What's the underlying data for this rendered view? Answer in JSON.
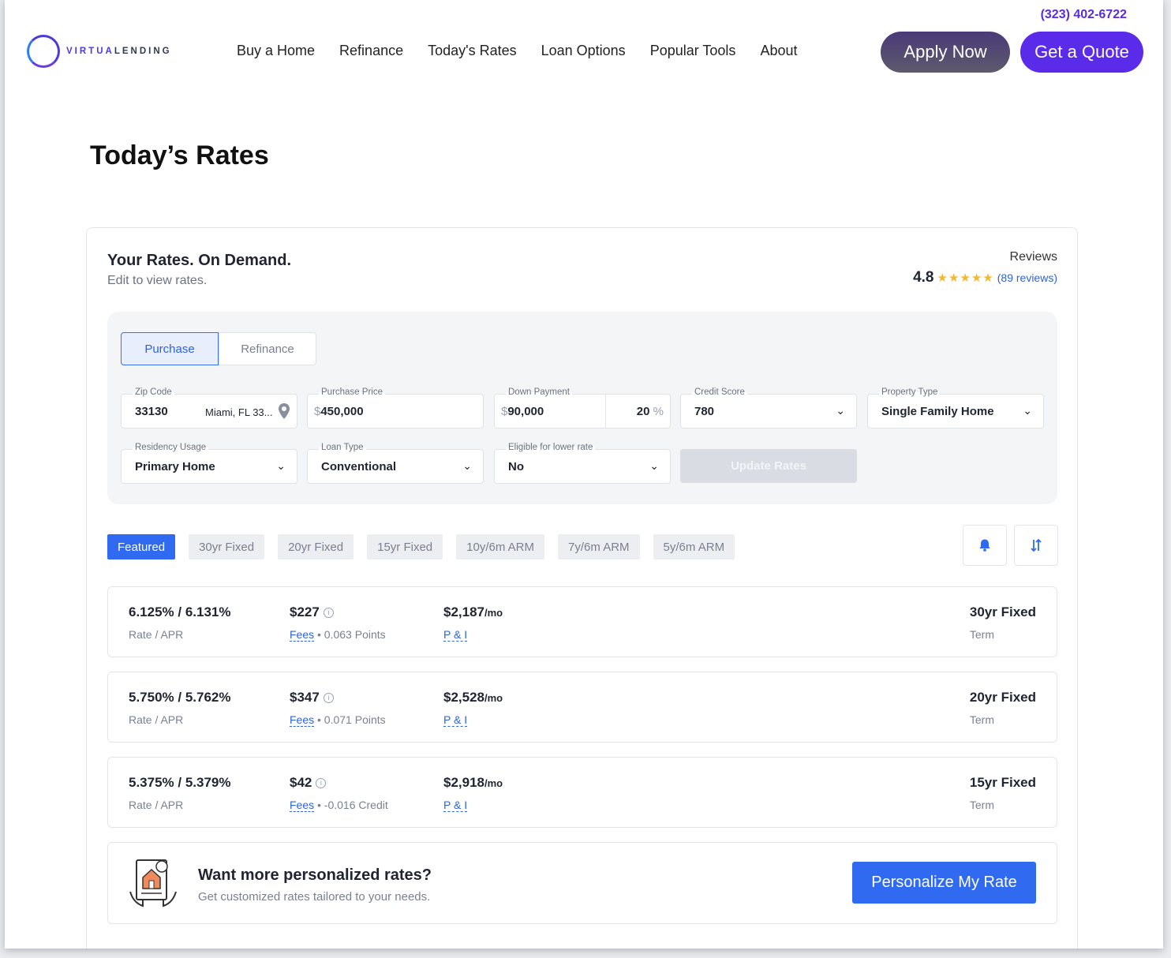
{
  "header": {
    "phone": "(323) 402-6722",
    "logo_prefix": "VIRTUA",
    "logo_suffix": "LENDING",
    "nav": [
      "Buy a Home",
      "Refinance",
      "Today's Rates",
      "Loan Options",
      "Popular Tools",
      "About"
    ],
    "apply_label": "Apply Now",
    "quote_label": "Get a Quote"
  },
  "page_title": "Today’s Rates",
  "card": {
    "title": "Your Rates. On Demand.",
    "subtitle": "Edit to view rates.",
    "reviews_label": "Reviews",
    "rating": "4.8",
    "stars": "★★★★★",
    "reviews_link": "(89 reviews)"
  },
  "form": {
    "segments": [
      "Purchase",
      "Refinance"
    ],
    "zip": {
      "label": "Zip Code",
      "value": "33130",
      "city": "Miami, FL 33..."
    },
    "purchase_price": {
      "label": "Purchase Price",
      "prefix": "$",
      "value": "450,000"
    },
    "down_payment": {
      "label": "Down Payment",
      "prefix": "$",
      "value": "90,000",
      "percent": "20",
      "percent_sign": "%"
    },
    "credit_score": {
      "label": "Credit Score",
      "value": "780"
    },
    "property_type": {
      "label": "Property Type",
      "value": "Single Family Home"
    },
    "residency": {
      "label": "Residency Usage",
      "value": "Primary Home"
    },
    "loan_type": {
      "label": "Loan Type",
      "value": "Conventional"
    },
    "eligible": {
      "label": "Eligible for lower rate",
      "value": "No"
    },
    "update_label": "Update Rates"
  },
  "tabs": [
    "Featured",
    "30yr Fixed",
    "20yr Fixed",
    "15yr Fixed",
    "10y/6m ARM",
    "7y/6m ARM",
    "5y/6m ARM"
  ],
  "rates": [
    {
      "rate": "6.125% / 6.131%",
      "rate_label": "Rate / APR",
      "fee": "$227",
      "fees_link": "Fees",
      "points": "• 0.063 Points",
      "payment": "$2,187",
      "per": "/mo",
      "pi": "P & I",
      "term": "30yr Fixed",
      "term_label": "Term"
    },
    {
      "rate": "5.750% / 5.762%",
      "rate_label": "Rate / APR",
      "fee": "$347",
      "fees_link": "Fees",
      "points": "• 0.071 Points",
      "payment": "$2,528",
      "per": "/mo",
      "pi": "P & I",
      "term": "20yr Fixed",
      "term_label": "Term"
    },
    {
      "rate": "5.375% / 5.379%",
      "rate_label": "Rate / APR",
      "fee": "$42",
      "fees_link": "Fees",
      "points": "• -0.016 Credit",
      "payment": "$2,918",
      "per": "/mo",
      "pi": "P & I",
      "term": "15yr Fixed",
      "term_label": "Term"
    }
  ],
  "personalize": {
    "title": "Want more personalized rates?",
    "subtitle": "Get customized rates tailored to your needs.",
    "button": "Personalize My Rate"
  },
  "colors": {
    "brand": "#5a2be8",
    "accent_blue": "#2f6af0",
    "star": "#f5b731"
  },
  "icons": [
    "location-pin-icon",
    "chevron-down-icon",
    "bell-icon",
    "sort-icon",
    "info-icon",
    "document-house-icon"
  ]
}
